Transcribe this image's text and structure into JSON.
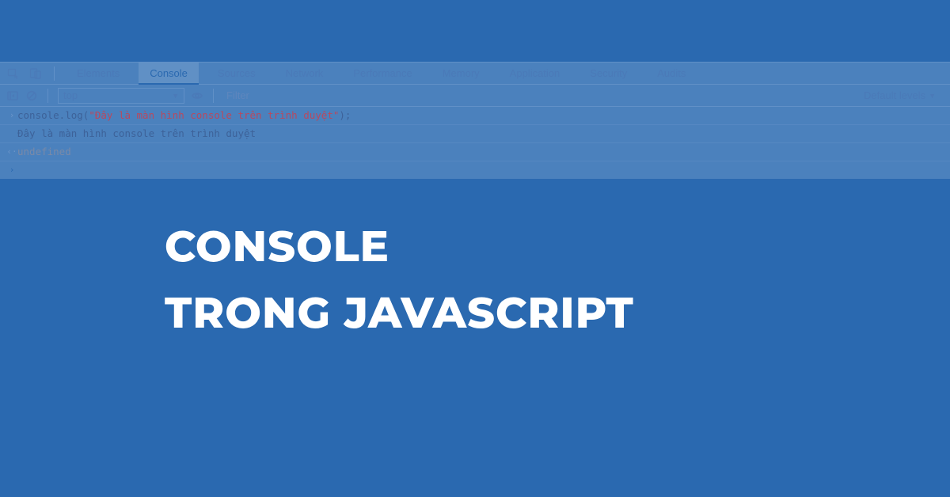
{
  "tabs": {
    "elements": "Elements",
    "console": "Console",
    "sources": "Sources",
    "network": "Network",
    "performance": "Performance",
    "memory": "Memory",
    "application": "Application",
    "security": "Security",
    "audits": "Audits"
  },
  "filterbar": {
    "context": "top",
    "filter_placeholder": "Filter",
    "levels": "Default levels"
  },
  "console": {
    "input_prefix": "console.log(",
    "input_str": "\"Đây là màn hình console trên trình duyệt\"",
    "input_suffix": ");",
    "output": "Đây là màn hình console trên trình duyệt",
    "return_value": "undefined"
  },
  "overlay": {
    "line1": "CONSOLE",
    "line2": "TRONG JAVASCRIPT"
  }
}
